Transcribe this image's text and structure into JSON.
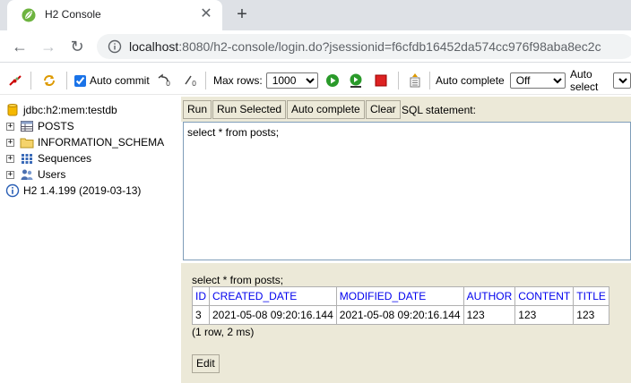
{
  "browser": {
    "tab_title": "H2 Console",
    "url_host": "localhost",
    "url_rest": ":8080/h2-console/login.do?jsessionid=f6cfdb16452da574cc976f98aba8ec2c"
  },
  "toolbar": {
    "auto_commit_label": "Auto commit",
    "auto_commit_checked": true,
    "max_rows_label": "Max rows:",
    "max_rows_value": "1000",
    "auto_complete_label": "Auto complete",
    "auto_complete_value": "Off",
    "auto_select_label": "Auto select"
  },
  "tree": {
    "connection": "jdbc:h2:mem:testdb",
    "items": [
      "POSTS",
      "INFORMATION_SCHEMA",
      "Sequences",
      "Users"
    ],
    "version": "H2 1.4.199 (2019-03-13)"
  },
  "editor": {
    "buttons": {
      "run": "Run",
      "run_selected": "Run Selected",
      "auto_complete": "Auto complete",
      "clear": "Clear"
    },
    "label": "SQL statement:",
    "sql": "select * from posts;"
  },
  "results": {
    "query": "select * from posts;",
    "columns": [
      "ID",
      "CREATED_DATE",
      "MODIFIED_DATE",
      "AUTHOR",
      "CONTENT",
      "TITLE"
    ],
    "rows": [
      [
        "3",
        "2021-05-08 09:20:16.144",
        "2021-05-08 09:20:16.144",
        "123",
        "123",
        "123"
      ]
    ],
    "summary": "(1 row, 2 ms)",
    "edit_label": "Edit"
  },
  "colors": {
    "panel_bg": "#ece9d8",
    "link_blue": "#0000ee",
    "button_border": "#aca899"
  }
}
